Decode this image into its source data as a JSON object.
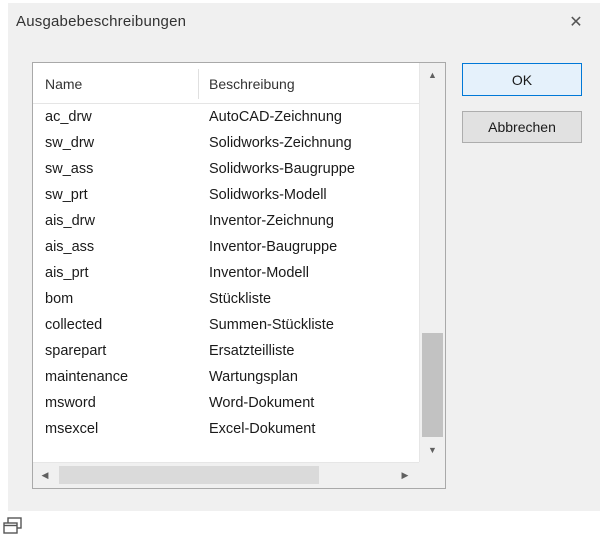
{
  "window": {
    "title": "Ausgabebeschreibungen",
    "close_glyph": "✕"
  },
  "list": {
    "columns": {
      "name": "Name",
      "description": "Beschreibung"
    },
    "rows": [
      {
        "name": "ac_drw",
        "description": "AutoCAD-Zeichnung"
      },
      {
        "name": "sw_drw",
        "description": "Solidworks-Zeichnung"
      },
      {
        "name": "sw_ass",
        "description": "Solidworks-Baugruppe"
      },
      {
        "name": "sw_prt",
        "description": "Solidworks-Modell"
      },
      {
        "name": "ais_drw",
        "description": "Inventor-Zeichnung"
      },
      {
        "name": "ais_ass",
        "description": "Inventor-Baugruppe"
      },
      {
        "name": "ais_prt",
        "description": "Inventor-Modell"
      },
      {
        "name": "bom",
        "description": "Stückliste"
      },
      {
        "name": "collected",
        "description": "Summen-Stückliste"
      },
      {
        "name": "sparepart",
        "description": "Ersatzteilliste"
      },
      {
        "name": "maintenance",
        "description": "Wartungsplan"
      },
      {
        "name": "msword",
        "description": "Word-Dokument"
      },
      {
        "name": "msexcel",
        "description": "Excel-Dokument"
      }
    ],
    "scroll_up_glyph": "▲",
    "scroll_down_glyph": "▼",
    "scroll_left_glyph": "◀",
    "scroll_right_glyph": "▶"
  },
  "buttons": {
    "ok_label": "OK",
    "cancel_label": "Abbrechen"
  },
  "icons": {
    "close": "close-icon",
    "restore": "restore-window-icon"
  },
  "colors": {
    "dialog_bg": "#f0f0f0",
    "ok_border": "#0078d7",
    "ok_bg": "#e5f1fb"
  }
}
